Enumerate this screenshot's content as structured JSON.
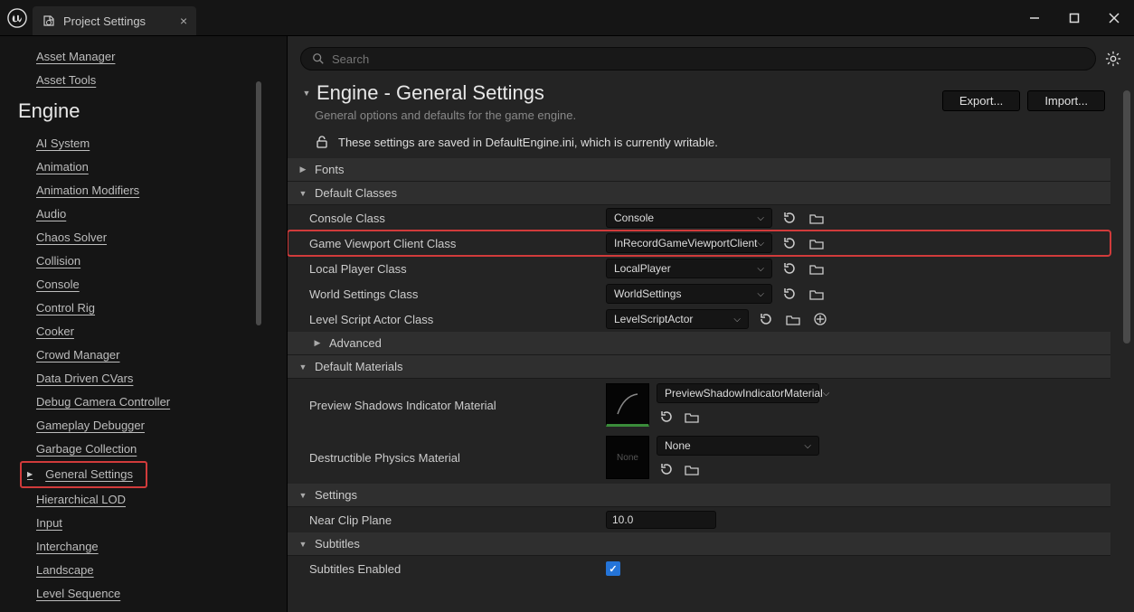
{
  "tab": {
    "title": "Project Settings"
  },
  "sidebar": {
    "header": "Engine",
    "top_items": [
      "Asset Manager",
      "Asset Tools"
    ],
    "items": [
      "AI System",
      "Animation",
      "Animation Modifiers",
      "Audio",
      "Chaos Solver",
      "Collision",
      "Console",
      "Control Rig",
      "Cooker",
      "Crowd Manager",
      "Data Driven CVars",
      "Debug Camera Controller",
      "Gameplay Debugger",
      "Garbage Collection",
      "General Settings",
      "Hierarchical LOD",
      "Input",
      "Interchange",
      "Landscape",
      "Level Sequence"
    ],
    "highlighted_index": 14
  },
  "search": {
    "placeholder": "Search"
  },
  "header": {
    "title": "Engine - General Settings",
    "desc": "General options and defaults for the game engine.",
    "save_note": "These settings are saved in DefaultEngine.ini, which is currently writable.",
    "export": "Export...",
    "import": "Import..."
  },
  "sections": {
    "fonts": "Fonts",
    "default_classes": "Default Classes",
    "advanced": "Advanced",
    "default_materials": "Default Materials",
    "settings": "Settings",
    "subtitles": "Subtitles"
  },
  "props": {
    "console_class": {
      "label": "Console Class",
      "value": "Console"
    },
    "viewport_class": {
      "label": "Game Viewport Client Class",
      "value": "InRecordGameViewportClient"
    },
    "local_player": {
      "label": "Local Player Class",
      "value": "LocalPlayer"
    },
    "world_settings": {
      "label": "World Settings Class",
      "value": "WorldSettings"
    },
    "level_script": {
      "label": "Level Script Actor Class",
      "value": "LevelScriptActor"
    },
    "preview_shadow": {
      "label": "Preview Shadows Indicator Material",
      "value": "PreviewShadowIndicatorMaterial"
    },
    "destructible": {
      "label": "Destructible Physics Material",
      "value": "None",
      "thumb": "None"
    },
    "near_clip": {
      "label": "Near Clip Plane",
      "value": "10.0"
    },
    "subtitles_enabled": {
      "label": "Subtitles Enabled",
      "value": true
    }
  }
}
